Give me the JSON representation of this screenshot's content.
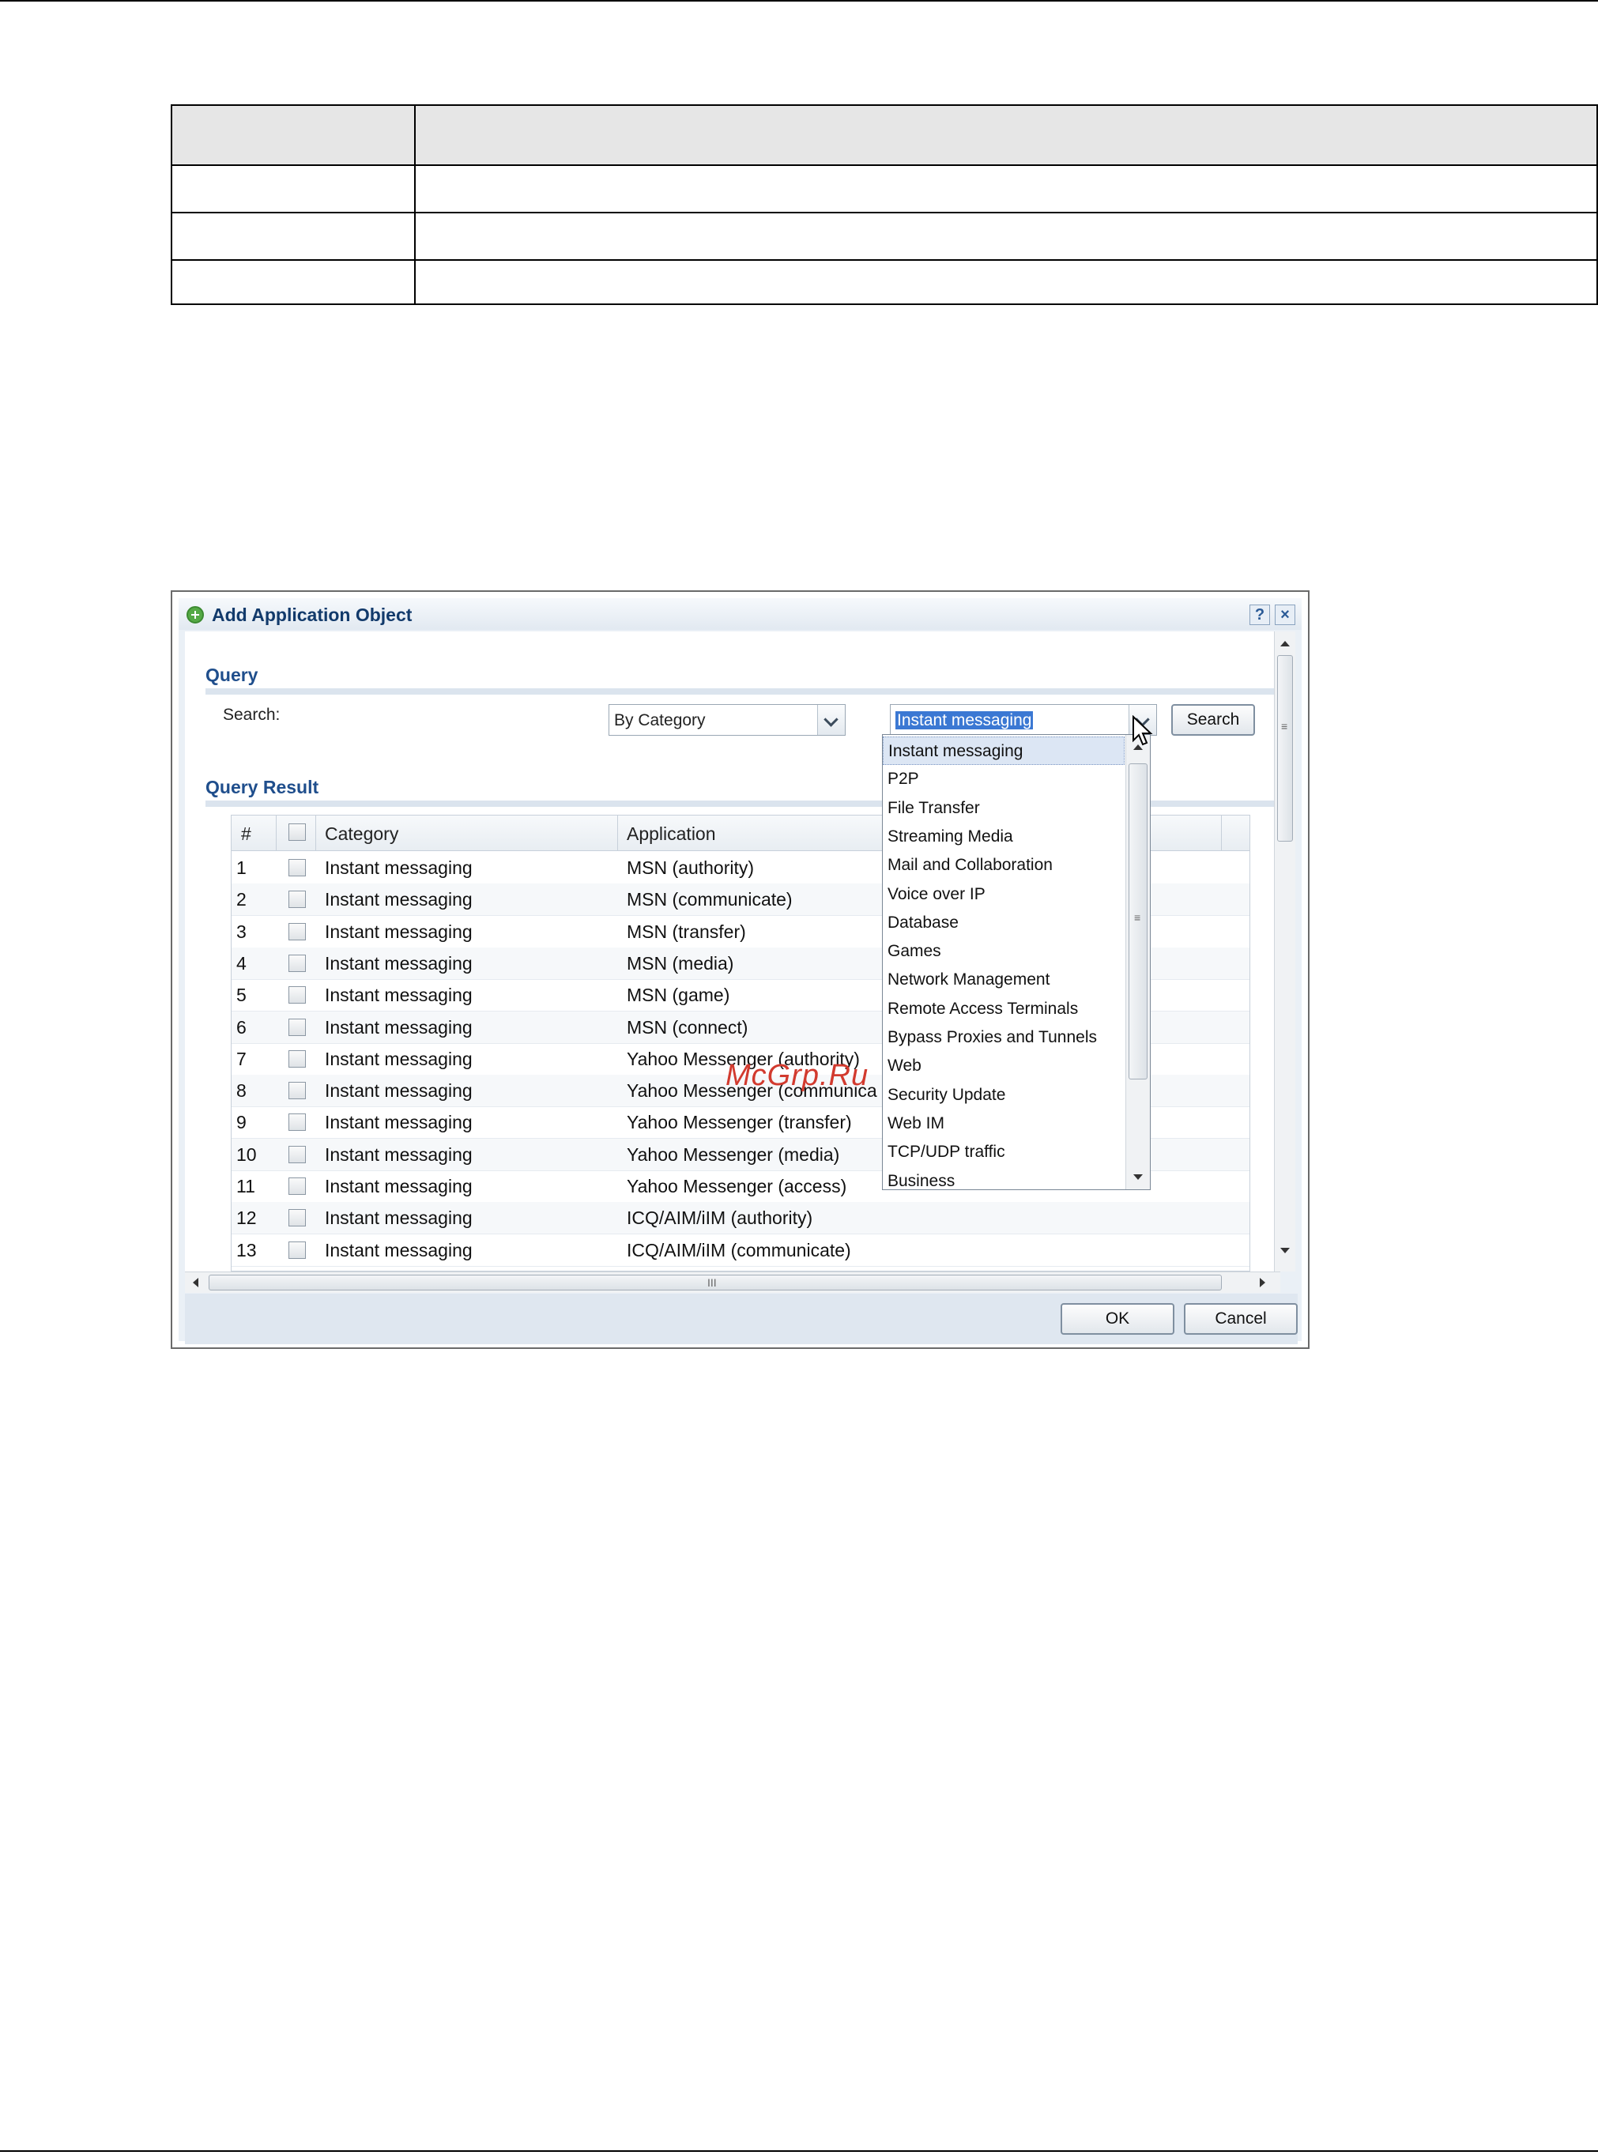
{
  "dialog": {
    "title": "Add Application Object",
    "help": "?",
    "close": "×"
  },
  "query": {
    "section_title": "Query",
    "search_label": "Search:",
    "search_by": "By Category",
    "category_value": "Instant messaging",
    "search_button": "Search"
  },
  "result": {
    "section_title": "Query Result",
    "columns": [
      "#",
      "Category",
      "Application"
    ],
    "rows": [
      {
        "num": "1",
        "category": "Instant messaging",
        "application": "MSN (authority)"
      },
      {
        "num": "2",
        "category": "Instant messaging",
        "application": "MSN (communicate)"
      },
      {
        "num": "3",
        "category": "Instant messaging",
        "application": "MSN (transfer)"
      },
      {
        "num": "4",
        "category": "Instant messaging",
        "application": "MSN (media)"
      },
      {
        "num": "5",
        "category": "Instant messaging",
        "application": "MSN (game)"
      },
      {
        "num": "6",
        "category": "Instant messaging",
        "application": "MSN (connect)"
      },
      {
        "num": "7",
        "category": "Instant messaging",
        "application": "Yahoo Messenger (authority)"
      },
      {
        "num": "8",
        "category": "Instant messaging",
        "application": "Yahoo Messenger (communica"
      },
      {
        "num": "9",
        "category": "Instant messaging",
        "application": "Yahoo Messenger (transfer)"
      },
      {
        "num": "10",
        "category": "Instant messaging",
        "application": "Yahoo Messenger (media)"
      },
      {
        "num": "11",
        "category": "Instant messaging",
        "application": "Yahoo Messenger (access)"
      },
      {
        "num": "12",
        "category": "Instant messaging",
        "application": "ICQ/AIM/iIM (authority)"
      },
      {
        "num": "13",
        "category": "Instant messaging",
        "application": "ICQ/AIM/iIM (communicate)"
      }
    ]
  },
  "dropdown": {
    "items": [
      "Instant messaging",
      "P2P",
      "File Transfer",
      "Streaming Media",
      "Mail and Collaboration",
      "Voice over IP",
      "Database",
      "Games",
      "Network Management",
      "Remote Access Terminals",
      "Bypass Proxies and Tunnels",
      "Web",
      "Security Update",
      "Web IM",
      "TCP/UDP traffic",
      "Business"
    ]
  },
  "buttons": {
    "ok": "OK",
    "cancel": "Cancel"
  },
  "scroll_grip": "III",
  "list_grip": "≡",
  "watermark": "McGrp.Ru",
  "colors": {
    "title_text": "#123a6b",
    "section_title": "#1f4e8c",
    "selection": "#3b78d3",
    "dialog_background": "#eaf0f6"
  }
}
